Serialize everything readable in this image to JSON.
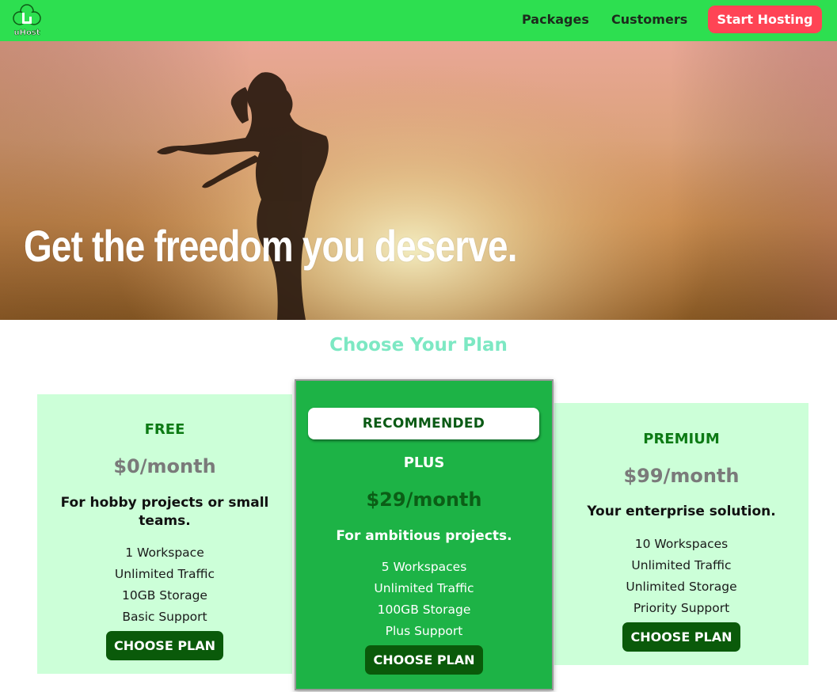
{
  "header": {
    "logo_text": "uHost",
    "nav": [
      "Packages",
      "Customers"
    ],
    "cta_label": "Start Hosting"
  },
  "hero": {
    "heading": "Get the freedom you deserve."
  },
  "plans_section": {
    "title": "Choose Your Plan",
    "plans": [
      {
        "name": "FREE",
        "price": "$0/month",
        "description": "For hobby projects or small teams.",
        "features": [
          "1 Workspace",
          "Unlimited Traffic",
          "10GB Storage",
          "Basic Support"
        ],
        "button_label": "CHOOSE PLAN"
      },
      {
        "badge": "RECOMMENDED",
        "name": "PLUS",
        "price": "$29/month",
        "description": "For ambitious projects.",
        "features": [
          "5 Workspaces",
          "Unlimited Traffic",
          "100GB Storage",
          "Plus Support"
        ],
        "button_label": "CHOOSE PLAN"
      },
      {
        "name": "PREMIUM",
        "price": "$99/month",
        "description": "Your enterprise solution.",
        "features": [
          "10 Workspaces",
          "Unlimited Traffic",
          "Unlimited Storage",
          "Priority Support"
        ],
        "button_label": "CHOOSE PLAN"
      }
    ]
  },
  "colors": {
    "header_bg": "#2ddf50",
    "cta_bg": "#ff4455",
    "title_color": "#7de8c3",
    "plan_bg": "#ccffd8",
    "featured_plan_bg": "#1db346",
    "button_bg": "#0a5a0a"
  }
}
